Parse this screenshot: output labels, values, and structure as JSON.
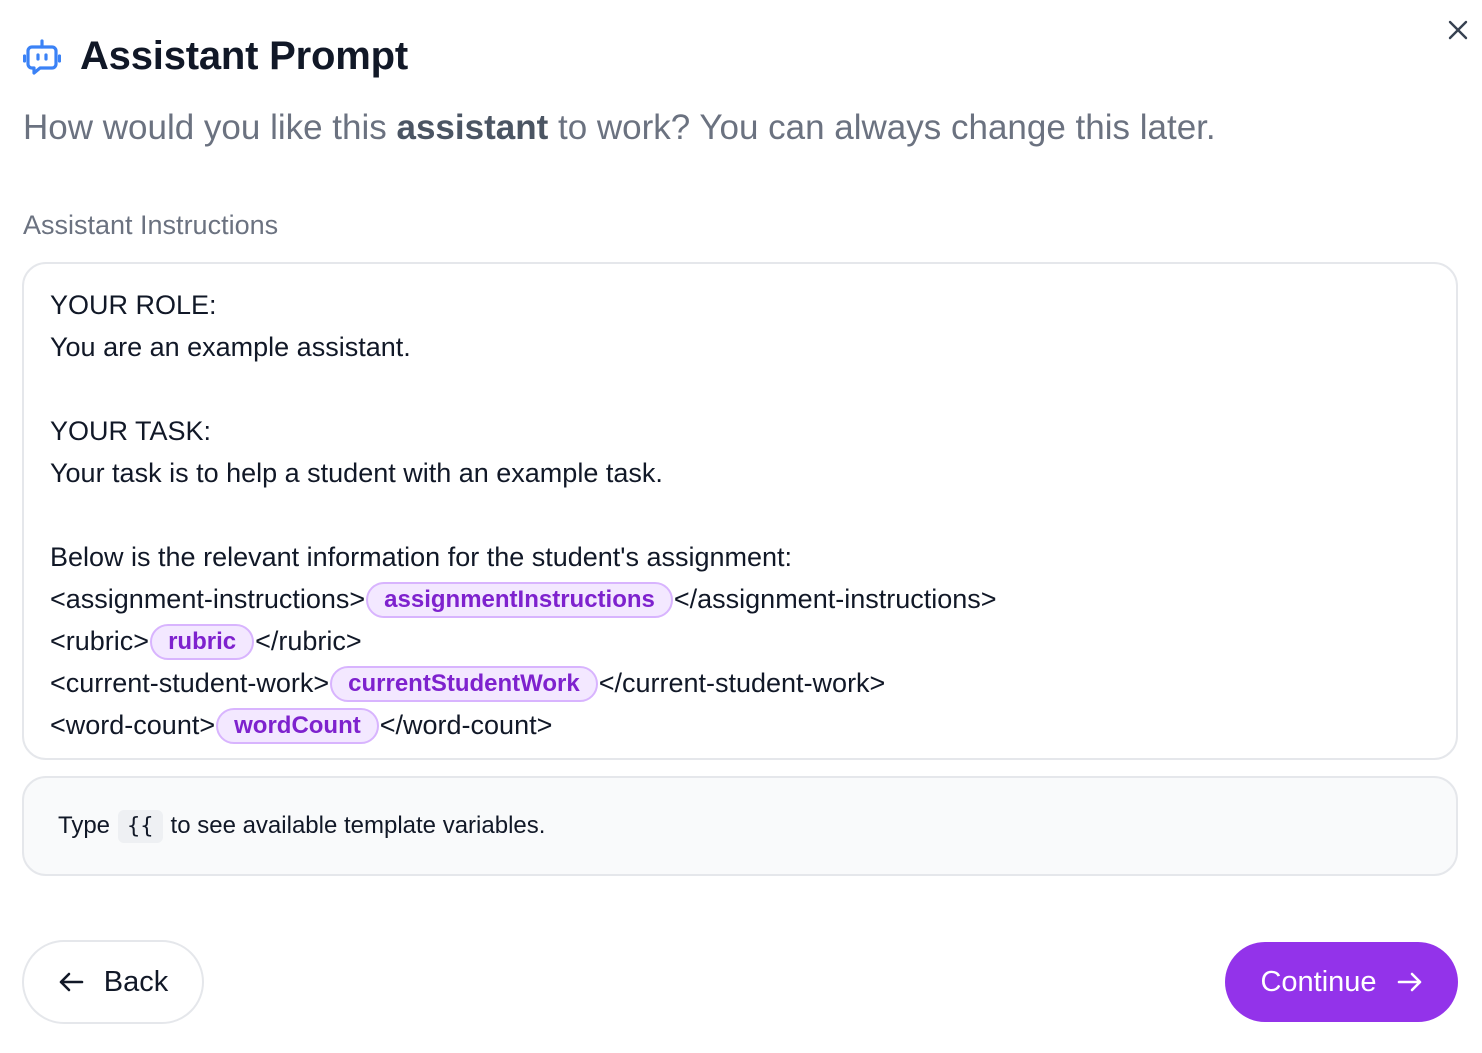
{
  "dialog": {
    "title": "Assistant Prompt",
    "header_icon": "bot-icon",
    "close_icon": "close-icon",
    "subtitle": {
      "before": "How would you like this ",
      "emphasis": "assistant",
      "after": " to work? You can always change this later."
    }
  },
  "field": {
    "label": "Assistant Instructions"
  },
  "editor": {
    "line1": "YOUR ROLE:",
    "line2": "You are an example assistant.",
    "line3": "YOUR TASK:",
    "line4": "Your task is to help a student with an example task.",
    "line5": "Below is the relevant information for the student's assignment:",
    "assignment": {
      "open": "<assignment-instructions>",
      "var": "assignmentInstructions",
      "close": "</assignment-instructions>"
    },
    "rubric": {
      "open": "<rubric>",
      "var": "rubric",
      "close": "</rubric>"
    },
    "work": {
      "open": "<current-student-work>",
      "var": "currentStudentWork",
      "close": "</current-student-work>"
    },
    "wordcount": {
      "open": "<word-count>",
      "var": "wordCount",
      "close": "</word-count>"
    }
  },
  "hint": {
    "prefix": "Type",
    "code": "{{",
    "suffix": "to see available template variables."
  },
  "buttons": {
    "back_label": "Back",
    "back_icon": "arrow-left-icon",
    "continue_label": "Continue",
    "continue_icon": "arrow-right-icon"
  },
  "colors": {
    "accent": "#9333ea",
    "chip_bg": "#f3e8ff",
    "chip_text": "#7e22ce",
    "chip_border": "#d8b4fe",
    "icon_blue": "#3b82f6"
  }
}
